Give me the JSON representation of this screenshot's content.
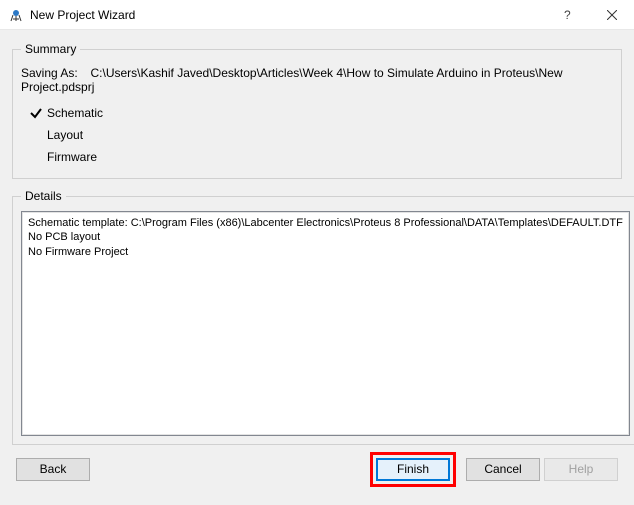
{
  "window": {
    "title": "New Project Wizard"
  },
  "summary": {
    "legend": "Summary",
    "saving_label": "Saving As:",
    "saving_path": "C:\\Users\\Kashif Javed\\Desktop\\Articles\\Week 4\\How to Simulate Arduino in Proteus\\New Project.pdsprj",
    "items": [
      {
        "label": "Schematic",
        "checked": true
      },
      {
        "label": "Layout",
        "checked": false
      },
      {
        "label": "Firmware",
        "checked": false
      }
    ]
  },
  "details": {
    "legend": "Details",
    "lines": "Schematic template: C:\\Program Files (x86)\\Labcenter Electronics\\Proteus 8 Professional\\DATA\\Templates\\DEFAULT.DTF\nNo PCB layout\nNo Firmware Project"
  },
  "buttons": {
    "back": "Back",
    "finish": "Finish",
    "cancel": "Cancel",
    "help": "Help"
  }
}
